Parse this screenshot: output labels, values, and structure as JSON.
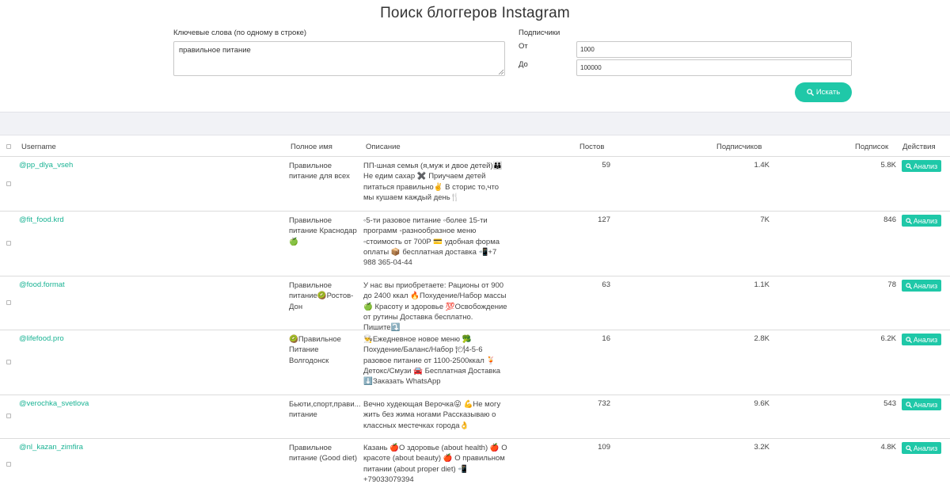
{
  "page": {
    "title": "Поиск блоггеров Instagram"
  },
  "form": {
    "keywords_label": "Ключевые слова (по одному в строке)",
    "keywords_value": "правильное питание",
    "subscribers_label": "Подписчики",
    "from_label": "От",
    "from_value": "1000",
    "to_label": "До",
    "to_value": "100000",
    "search_button": "Искать",
    "accent_color": "#1fc8a8"
  },
  "table": {
    "headers": {
      "username": "Username",
      "fullname": "Полное имя",
      "description": "Описание",
      "posts": "Постов",
      "followers": "Подписчиков",
      "following": "Подписок",
      "actions": "Действия"
    },
    "action_label": "Анализ",
    "rows": [
      {
        "username": "@pp_dlya_vseh",
        "fullname": "Правильное питание для всех",
        "description": "ПП-шная семья (я,муж и двое детей)👪 Не едим сахар ✖️ Приучаем детей питаться правильно✌️ В сторис то,что мы кушаем каждый день🍴",
        "posts": "59",
        "followers": "1.4K",
        "following": "5.8K"
      },
      {
        "username": "@fit_food.krd",
        "fullname": "Правильное питание Краснодар 🍏",
        "description": "◦5-ти разовое питание ◦более 15-ти программ ◦разнообразное меню ◦стоимость от 700Р 💳 удобная форма оплаты 📦 бесплатная доставка 📲+7 988 365-04-44",
        "posts": "127",
        "followers": "7K",
        "following": "846"
      },
      {
        "username": "@food.format",
        "fullname": "Правильное питание🥝Ростов-Дон",
        "description": "У нас вы приобретаете: Рационы от 900 до 2400 ккал 🔥Похудение/Набор массы 🍏 Красоту и здоровье 💯Освобождение от рутины Доставка бесплатно. Пишите⤵️",
        "posts": "63",
        "followers": "1.1K",
        "following": "78"
      },
      {
        "username": "@lifefood.pro",
        "fullname": "🥝Правильное Питание Волгодонск",
        "description": "👨‍🍳Ежедневное новое меню 🥦Похудение/Баланс/Набор 🍽4-5-6 разовое питание от 1100-2500ккал 🍹Детокс/Смузи 🚘 Бесплатная Доставка ⬇️Заказать WhatsApp",
        "posts": "16",
        "followers": "2.8K",
        "following": "6.2K"
      },
      {
        "username": "@verochka_svetlova",
        "fullname_line1": "Бьюти,спорт,прави...",
        "fullname_line2": "питание",
        "description": "Вечно худеющая Верочка😜 💪Не могу жить без жима ногами Рассказываю о классных местечках города👌",
        "posts": "732",
        "followers": "9.6K",
        "following": "543"
      },
      {
        "username": "@nl_kazan_zimfira",
        "fullname": "Правильное питание (Good diet)",
        "description": "Казань 🍎О здоровье (about health) 🍎 О красоте (about beauty) 🍎 О правильном питании (about proper diet) 📲 +79033079394",
        "posts": "109",
        "followers": "3.2K",
        "following": "4.8K"
      }
    ]
  }
}
